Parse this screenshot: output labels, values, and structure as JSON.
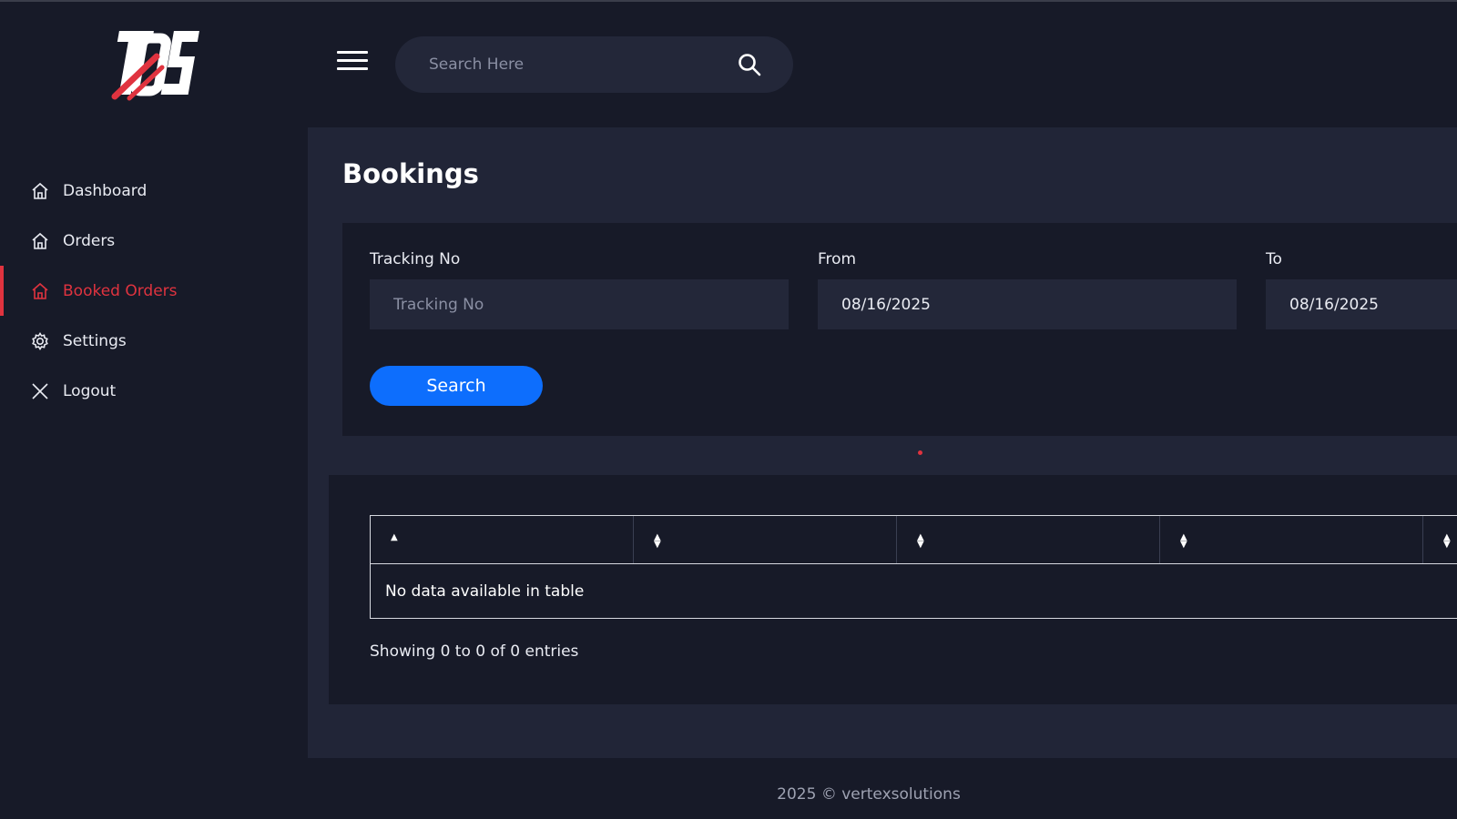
{
  "logo": {
    "text": "TQS"
  },
  "sidebar": {
    "items": [
      {
        "label": "Dashboard",
        "icon": "home-icon",
        "active": false
      },
      {
        "label": "Orders",
        "icon": "home-icon",
        "active": false
      },
      {
        "label": "Booked Orders",
        "icon": "home-icon",
        "active": true
      },
      {
        "label": "Settings",
        "icon": "gear-icon",
        "active": false
      },
      {
        "label": "Logout",
        "icon": "close-icon",
        "active": false
      }
    ]
  },
  "header": {
    "search_placeholder": "Search Here"
  },
  "page": {
    "title": "Bookings"
  },
  "filters": {
    "tracking": {
      "label": "Tracking No",
      "placeholder": "Tracking No",
      "value": ""
    },
    "from": {
      "label": "From",
      "value": "08/16/2025"
    },
    "to": {
      "label": "To",
      "value": "08/16/2025"
    },
    "search_label": "Search"
  },
  "table": {
    "empty_message": "No data available in table",
    "info": "Showing 0 to 0 of 0 entries"
  },
  "footer": {
    "text": "2025 © vertexsolutions"
  },
  "colors": {
    "accent": "#e0333f",
    "primary": "#0d6efd",
    "background": "#171a28",
    "panel": "#212537"
  }
}
